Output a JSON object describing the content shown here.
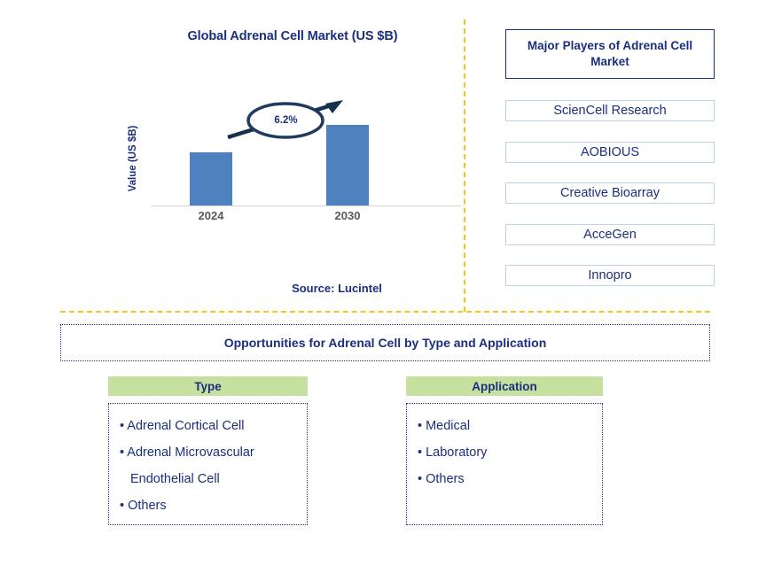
{
  "chart_panel": {
    "title": "Global Adrenal Cell Market (US $B)",
    "y_axis_label": "Value (US $B)",
    "cagr_label": "6.2%",
    "source": "Source: Lucintel"
  },
  "chart_data": {
    "type": "bar",
    "title": "Global Adrenal Cell Market (US $B)",
    "categories": [
      "2024",
      "2030"
    ],
    "values": [
      60,
      91
    ],
    "xlabel": "",
    "ylabel": "Value (US $B)",
    "ylim": [
      0,
      100
    ],
    "grid": false,
    "legend": "none",
    "bar_color": "#4E81BD",
    "annotations": [
      {
        "text": "6.2%",
        "type": "cagr-arrow-bubble",
        "between": [
          "2024",
          "2030"
        ]
      }
    ],
    "tick_label_color": "#595959",
    "axis_line_color": "#D4D4D4"
  },
  "players_panel": {
    "header": "Major Players of Adrenal Cell Market",
    "items": [
      "ScienCell Research",
      "AOBIOUS",
      "Creative Bioarray",
      "AcceGen",
      "Innopro"
    ]
  },
  "opportunities": {
    "banner": "Opportunities for Adrenal Cell by Type and Application",
    "columns": [
      {
        "heading": "Type",
        "lines": [
          {
            "text": "• Adrenal Cortical Cell",
            "continuation": false
          },
          {
            "text": "• Adrenal Microvascular",
            "continuation": false
          },
          {
            "text": "Endothelial Cell",
            "continuation": true
          },
          {
            "text": "• Others",
            "continuation": false
          }
        ]
      },
      {
        "heading": "Application",
        "lines": [
          {
            "text": "• Medical",
            "continuation": false
          },
          {
            "text": "• Laboratory",
            "continuation": false
          },
          {
            "text": "• Others",
            "continuation": false
          }
        ]
      }
    ]
  },
  "theme": {
    "navy": "#1B2F7F",
    "bar_blue": "#4E81BD",
    "divider_gold": "#F5C518",
    "green": "#C6E0A0",
    "item_border": "#BBD2EA"
  }
}
